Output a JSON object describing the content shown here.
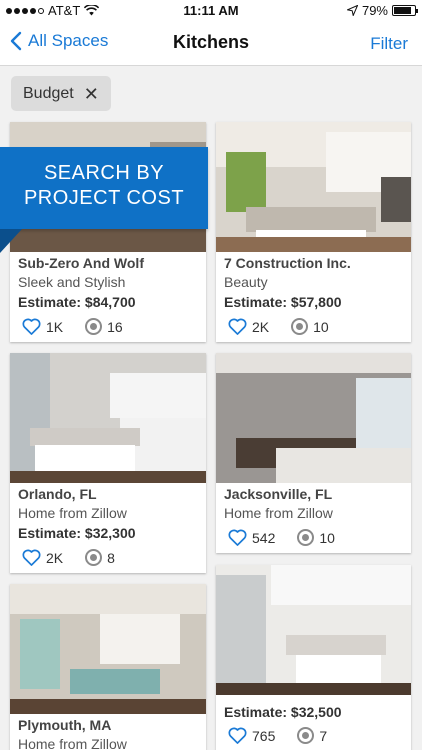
{
  "status_bar": {
    "carrier": "AT&T",
    "time": "11:11 AM",
    "battery": "79%",
    "battery_level": 0.79
  },
  "nav": {
    "back_label": "All Spaces",
    "title": "Kitchens",
    "filter_label": "Filter"
  },
  "chip": {
    "label": "Budget",
    "remove_symbol": "✕"
  },
  "banner": {
    "line1": "SEARCH BY",
    "line2": "PROJECT COST"
  },
  "cards": [
    {
      "name": "Sub-Zero And Wolf",
      "subtitle": "Sleek and Stylish",
      "estimate": "Estimate: $84,700",
      "likes": "1K",
      "views": "16"
    },
    {
      "name": "7 Construction Inc.",
      "subtitle": "Beauty",
      "estimate": "Estimate: $57,800",
      "likes": "2K",
      "views": "10"
    },
    {
      "name": "Orlando, FL",
      "subtitle": "Home from Zillow",
      "estimate": "Estimate: $32,300",
      "likes": "2K",
      "views": "8"
    },
    {
      "name": "Jacksonville, FL",
      "subtitle": "Home from Zillow",
      "estimate": "",
      "likes": "542",
      "views": "10"
    },
    {
      "name": "Plymouth, MA",
      "subtitle": "Home from Zillow",
      "estimate": "",
      "likes": "",
      "views": ""
    },
    {
      "name": "",
      "subtitle": "",
      "estimate": "Estimate: $32,500",
      "likes": "765",
      "views": "7"
    }
  ],
  "colors": {
    "accent": "#1a7ad6",
    "banner": "#0f71c6",
    "heart": "#1a7ad6"
  }
}
